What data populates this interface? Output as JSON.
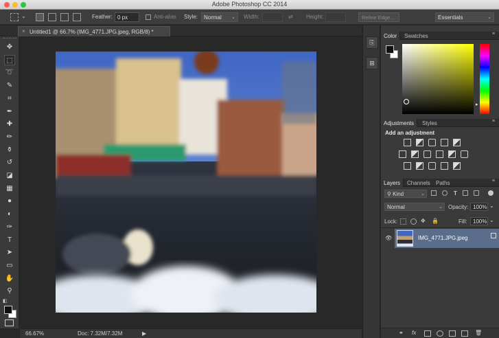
{
  "window": {
    "title": "Adobe Photoshop CC 2014"
  },
  "options_bar": {
    "feather_label": "Feather:",
    "feather_value": "0 px",
    "antialias_label": "Anti-alias",
    "style_label": "Style:",
    "style_value": "Normal",
    "width_label": "Width:",
    "height_label": "Height:",
    "refine_edge_label": "Refine Edge...",
    "workspace_value": "Essentials"
  },
  "document_tab": {
    "label": "Untitled1 @ 66.7% (IMG_4771.JPG.jpeg, RGB/8) *",
    "close_glyph": "×"
  },
  "tools": [
    {
      "name": "move-tool-icon",
      "glyph": "✥"
    },
    {
      "name": "marquee-tool-icon",
      "glyph": "⬚"
    },
    {
      "name": "lasso-tool-icon",
      "glyph": "➰"
    },
    {
      "name": "quick-select-tool-icon",
      "glyph": "✎"
    },
    {
      "name": "crop-tool-icon",
      "glyph": "⌗"
    },
    {
      "name": "eyedropper-tool-icon",
      "glyph": "✒"
    },
    {
      "name": "healing-brush-tool-icon",
      "glyph": "✚"
    },
    {
      "name": "brush-tool-icon",
      "glyph": "✏"
    },
    {
      "name": "clone-stamp-tool-icon",
      "glyph": "⚱"
    },
    {
      "name": "history-brush-tool-icon",
      "glyph": "↺"
    },
    {
      "name": "eraser-tool-icon",
      "glyph": "◪"
    },
    {
      "name": "gradient-tool-icon",
      "glyph": "▦"
    },
    {
      "name": "blur-tool-icon",
      "glyph": "●"
    },
    {
      "name": "dodge-tool-icon",
      "glyph": "◐"
    },
    {
      "name": "pen-tool-icon",
      "glyph": "✑"
    },
    {
      "name": "type-tool-icon",
      "glyph": "T"
    },
    {
      "name": "path-select-tool-icon",
      "glyph": "➤"
    },
    {
      "name": "shape-tool-icon",
      "glyph": "▭"
    },
    {
      "name": "hand-tool-icon",
      "glyph": "✋"
    },
    {
      "name": "zoom-tool-icon",
      "glyph": "⚲"
    }
  ],
  "status_bar": {
    "zoom": "66.67%",
    "doc_info": "Doc: 7.32M/7.32M",
    "arrow": "▶"
  },
  "color_panel": {
    "tab_color": "Color",
    "tab_swatches": "Swatches"
  },
  "adjustments_panel": {
    "tab_adjustments": "Adjustments",
    "tab_styles": "Styles",
    "heading": "Add an adjustment"
  },
  "layers_panel": {
    "tab_layers": "Layers",
    "tab_channels": "Channels",
    "tab_paths": "Paths",
    "kind_value": "⚲ Kind",
    "blend_mode": "Normal",
    "opacity_label": "Opacity:",
    "opacity_value": "100%",
    "lock_label": "Lock:",
    "fill_label": "Fill:",
    "fill_value": "100%",
    "layer_name": "IMG_4771.JPG.jpeg",
    "eye_glyph": "👁"
  },
  "menu_glyph": "≡",
  "chevron_glyph": "⌄",
  "colors": {
    "accent_selected_layer": "#5a6d8a",
    "panel_bg": "#3a3a3a",
    "canvas_bg": "#282828"
  }
}
